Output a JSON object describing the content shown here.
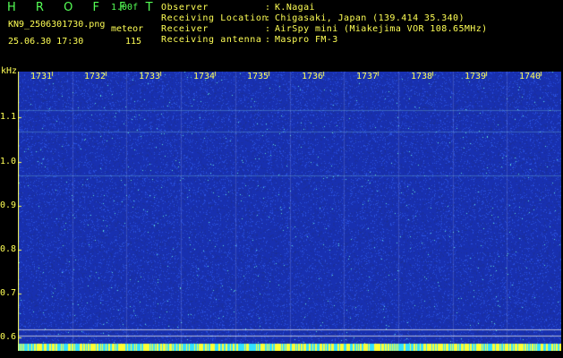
{
  "brand": "H R O F F T",
  "version": "1.00f",
  "filename": "KN9_2506301730.png",
  "datetime": "25.06.30 17:30",
  "meteor_label": "meteor",
  "meteor_count": "115",
  "info": [
    {
      "label": "Observer",
      "value": "K.Nagai"
    },
    {
      "label": "Receiving Location",
      "value": "Chigasaki, Japan (139.414 35.340)"
    },
    {
      "label": "Receiver",
      "value": "AirSpy mini (Miakejima VOR 108.65MHz)"
    },
    {
      "label": "Receiving antenna",
      "value": "Maspro FM-3"
    }
  ],
  "separator": ":",
  "chart_data": {
    "type": "heatmap",
    "ylabel": "kHz",
    "y_ticks": [
      "1.1",
      "1.0",
      "0.9",
      "0.8",
      "0.7",
      "0.6"
    ],
    "x_ticks": [
      "1731",
      "1732",
      "1733",
      "1734",
      "1735",
      "1736",
      "1737",
      "1738",
      "1739",
      "1740"
    ],
    "ylim": [
      0.585,
      1.205
    ],
    "colors": {
      "background": "#1830b0",
      "noise_low": "#2a52e0",
      "noise_high": "#5fe0d8",
      "axis": "#ffff55"
    }
  }
}
